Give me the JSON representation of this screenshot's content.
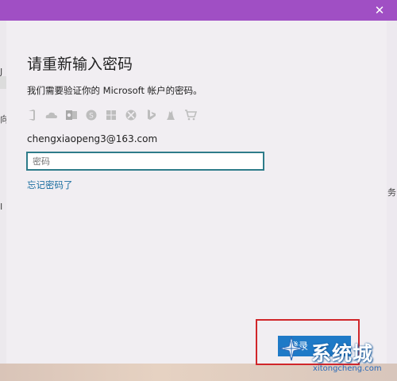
{
  "window": {
    "close_glyph": "✕"
  },
  "background": {
    "left_chars": [
      "J",
      "向",
      "I"
    ],
    "right_char": "务"
  },
  "dialog": {
    "title": "请重新输入密码",
    "subtitle": "我们需要验证你的 Microsoft 帐户的密码。",
    "product_icons": [
      "office-icon",
      "onedrive-icon",
      "outlook-icon",
      "skype-icon",
      "windows-icon",
      "xbox-icon",
      "bing-icon",
      "msn-icon",
      "store-icon"
    ],
    "email": "chengxiaopeng3@163.com",
    "password": {
      "value": "",
      "placeholder": "密码"
    },
    "forgot_link": "忘记密码了",
    "signin_label": "登录"
  },
  "watermark": {
    "text": "系统城",
    "url": "xitongcheng.com"
  },
  "colors": {
    "titlebar": "#a04fc4",
    "accent": "#1f7ac7",
    "link": "#1a6ea0",
    "highlight": "#d0262a"
  }
}
